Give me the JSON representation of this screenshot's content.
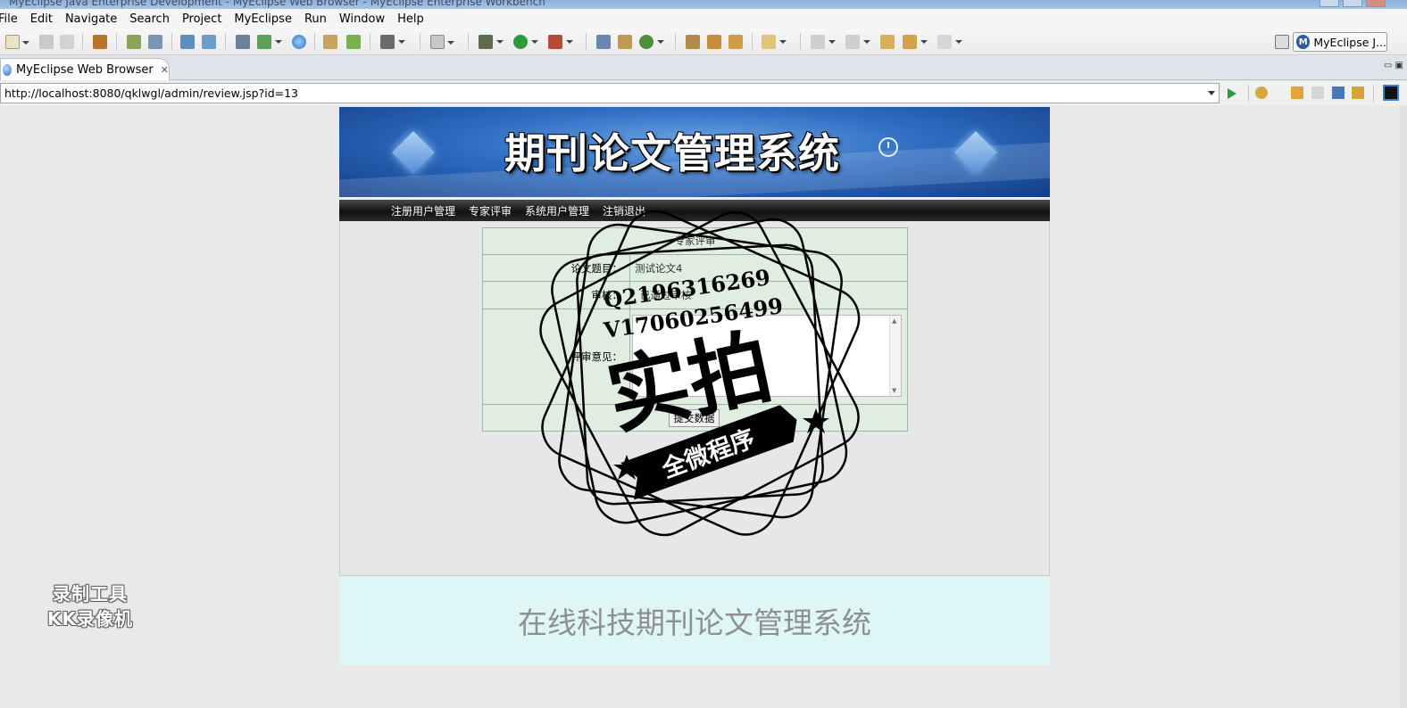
{
  "window": {
    "title": "MyEclipse Java Enterprise Development - MyEclipse Web Browser - MyEclipse Enterprise Workbench"
  },
  "menu": [
    "File",
    "Edit",
    "Navigate",
    "Search",
    "Project",
    "MyEclipse",
    "Run",
    "Window",
    "Help"
  ],
  "toolbar": {
    "perspective_label": "MyEclipse J...",
    "perspective_icon": "M"
  },
  "editor_tab": {
    "label": "MyEclipse Web Browser",
    "close_glyph": "✕"
  },
  "browser": {
    "url": "http://localhost:8080/qklwgl/admin/review.jsp?id=13"
  },
  "site": {
    "banner_title": "期刊论文管理系统",
    "nav": [
      "注册用户管理",
      "专家评审",
      "系统用户管理",
      "注销退出"
    ],
    "form": {
      "caption": "专家评审",
      "title_label": "论文题目：",
      "title_value": "测试论文4",
      "status_label": "审核：",
      "status_value": "已通过审核",
      "comment_label": "评审意见：",
      "submit_label": "提交数据"
    },
    "footer_text": "在线科技期刊论文管理系统"
  },
  "watermark": {
    "line1": "Q2196316269",
    "line2": "V17060256499",
    "big_text": "实拍",
    "ribbon_text": "全微程序"
  },
  "recorder_badge": {
    "line1": "录制工具",
    "line2": "KK录像机"
  }
}
